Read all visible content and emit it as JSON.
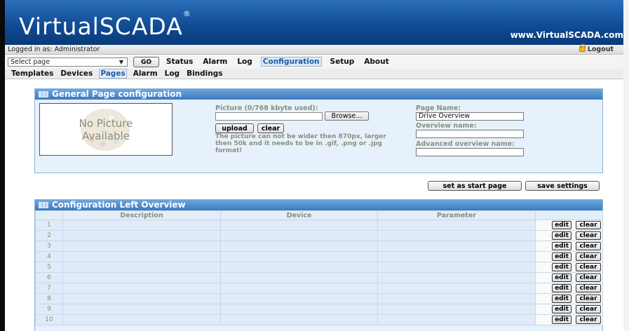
{
  "header": {
    "logo": "VirtualSCADA",
    "registered_mark": "®",
    "site_url": "www.VirtualSCADA.com"
  },
  "loginbar": {
    "logged_in_text": "Logged in as: Administrator",
    "logout_label": "Logout",
    "logout_icon": "lock-icon"
  },
  "menubar": {
    "select_value": "Select page",
    "go_label": "GO",
    "items": [
      "Status",
      "Alarm",
      "Log",
      "Configuration",
      "Setup",
      "About"
    ],
    "active": "Configuration"
  },
  "submenu": {
    "items": [
      "Templates",
      "Devices",
      "Pages",
      "Alarm",
      "Log",
      "Bindings"
    ],
    "active": "Pages"
  },
  "general_panel": {
    "title": "General Page configuration",
    "no_picture_line1": "No Picture",
    "no_picture_line2": "Available",
    "picture_label": "Picture (0/768 kbyte used):",
    "browse_label": "Browse...",
    "upload_label": "upload",
    "clear_label": "clear",
    "picture_note": "The picture can not be wider then 870px, larger then 50k and it needs to be in .gif, .png or .jpg format!",
    "page_name_label": "Page Name:",
    "page_name_value": "Drive Overview",
    "overview_name_label": "Overview name:",
    "overview_name_value": "",
    "advanced_overview_label": "Advanced overview name:",
    "advanced_overview_value": ""
  },
  "actions": {
    "set_start_label": "set as start page",
    "save_label": "save settings"
  },
  "left_overview": {
    "title": "Configuration Left Overview",
    "columns": [
      "",
      "Description",
      "Device",
      "Parameter",
      ""
    ],
    "rows": [
      "1",
      "2",
      "3",
      "4",
      "5",
      "6",
      "7",
      "8",
      "9",
      "10"
    ],
    "edit_label": "edit",
    "clear_label": "clear"
  },
  "colors": {
    "header_blue": "#0f4a94",
    "panel_title_blue": "#3a79c0",
    "panel_bg": "#e6f1fb",
    "muted_label": "#8c8f7c"
  }
}
